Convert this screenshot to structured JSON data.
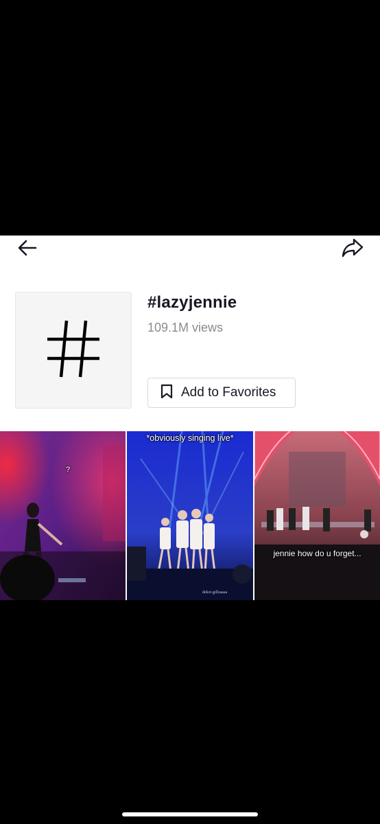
{
  "header": {
    "back_icon": "arrow-left-icon",
    "share_icon": "share-arrow-icon"
  },
  "hashtag": {
    "icon": "hash-icon",
    "title": "#lazyjennie",
    "views": "109.1M views",
    "favorite_label": "Add to Favorites",
    "favorite_icon": "bookmark-icon"
  },
  "videos": [
    {
      "caption": "?"
    },
    {
      "caption": "*obviously singing live*",
      "watermark": "dekot gillzaaaa"
    },
    {
      "caption": "jennie how do u forget..."
    }
  ]
}
